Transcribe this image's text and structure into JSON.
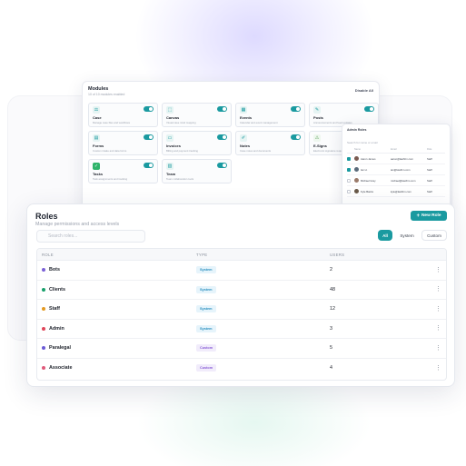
{
  "modules": {
    "title": "Modules",
    "subtitle": "10 of 10 modules enabled",
    "disable_all": "Disable All",
    "items": [
      {
        "name": "Case",
        "desc": "Manage case files and workflows",
        "icon": "case-icon",
        "glyph": "⚖",
        "enabled": true
      },
      {
        "name": "Canvas",
        "desc": "Visual case mind mapping",
        "icon": "canvas-icon",
        "glyph": "⬚",
        "enabled": true
      },
      {
        "name": "Events",
        "desc": "Calendar and event management",
        "icon": "events-icon",
        "glyph": "▦",
        "enabled": true
      },
      {
        "name": "Posts",
        "desc": "Announcements and feed updates",
        "icon": "posts-icon",
        "glyph": "✎",
        "enabled": true
      },
      {
        "name": "Forms",
        "desc": "Custom intake and data forms",
        "icon": "forms-icon",
        "glyph": "▤",
        "enabled": true
      },
      {
        "name": "Invoices",
        "desc": "Billing and payment tracking",
        "icon": "invoices-icon",
        "glyph": "▭",
        "enabled": true
      },
      {
        "name": "Notes",
        "desc": "Case notes and documents",
        "icon": "notes-icon",
        "glyph": "✐",
        "enabled": true
      },
      {
        "name": "E-Signs",
        "desc": "Electronic signature requests",
        "icon": "esigns-icon",
        "glyph": "⚠",
        "enabled": true
      },
      {
        "name": "Tasks",
        "desc": "Task assignments and tracking",
        "icon": "tasks-icon",
        "glyph": "✓",
        "enabled": true
      },
      {
        "name": "Team",
        "desc": "Team collaboration tools",
        "icon": "team-icon",
        "glyph": "▥",
        "enabled": true
      }
    ]
  },
  "users_panel": {
    "title": "Admin Roles",
    "search": "Search for name or email",
    "columns": [
      "",
      "Name",
      "Email",
      "Role"
    ],
    "rows": [
      {
        "checked": true,
        "name": "Aaron James",
        "email": "aaron@lawfirm.com",
        "role": "Staff"
      },
      {
        "checked": true,
        "name": "Ian H.",
        "email": "ian@lawfirm.com",
        "role": "Staff"
      },
      {
        "checked": false,
        "name": "Michael Gray",
        "email": "michael@lawfirm.com",
        "role": "Staff"
      },
      {
        "checked": false,
        "name": "Kyle Banks",
        "email": "kyle@lawfirm.com",
        "role": "Staff"
      }
    ]
  },
  "roles": {
    "title": "Roles",
    "subtitle": "Manage permissions and access levels",
    "new_role": "New Role",
    "search_placeholder": "Search roles...",
    "filters": {
      "all": "All",
      "system": "System",
      "custom": "Custom"
    },
    "columns": {
      "role": "ROLE",
      "type": "TYPE",
      "users": "USERS"
    },
    "rows": [
      {
        "name": "Bots",
        "type": "System",
        "users": "2",
        "dot": "#7b61d6"
      },
      {
        "name": "Clients",
        "type": "System",
        "users": "48",
        "dot": "#18a06b"
      },
      {
        "name": "Staff",
        "type": "System",
        "users": "12",
        "dot": "#e49a22"
      },
      {
        "name": "Admin",
        "type": "System",
        "users": "3",
        "dot": "#e0465a"
      },
      {
        "name": "Paralegal",
        "type": "Custom",
        "users": "5",
        "dot": "#6a5ad6"
      },
      {
        "name": "Associate",
        "type": "Custom",
        "users": "4",
        "dot": "#e05a7a"
      }
    ]
  },
  "colors": {
    "accent": "#1a9aa0",
    "system_badge": "#2a8fbf",
    "custom_badge": "#8a5ed6"
  }
}
